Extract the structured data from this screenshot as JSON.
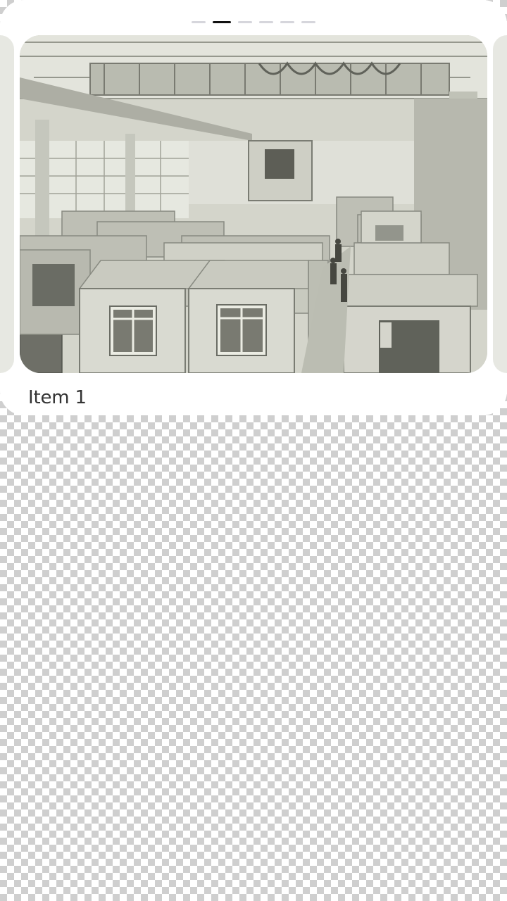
{
  "carousel": {
    "dot_count": 6,
    "active_index": 1,
    "items": [
      {
        "caption": "Item 1",
        "image": "factory-photo"
      }
    ]
  },
  "colors": {
    "sheet": "#ffffff",
    "dot_inactive": "#d6d6dc",
    "dot_active": "#111111",
    "caption_text": "#333333"
  }
}
